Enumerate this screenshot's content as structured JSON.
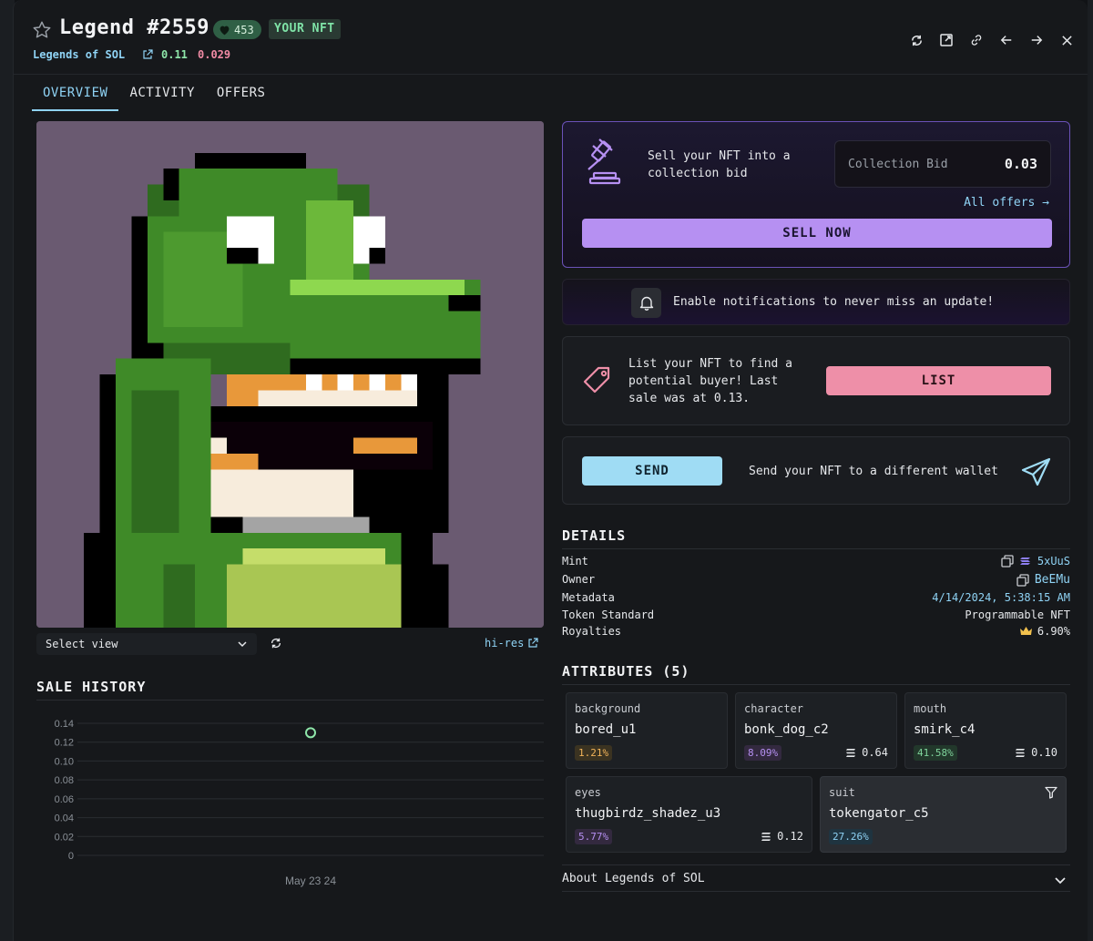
{
  "header": {
    "title": "Legend #2559",
    "likes": "453",
    "owner_badge": "YOUR NFT",
    "collection": "Legends of SOL",
    "floor_price": "0.11",
    "floor_change": "0.029",
    "actions": [
      "refresh-icon",
      "external-link-icon",
      "link-icon",
      "arrow-left-icon",
      "arrow-right-icon",
      "close-icon"
    ]
  },
  "tabs": [
    {
      "label": "OVERVIEW",
      "active": true
    },
    {
      "label": "ACTIVITY",
      "active": false
    },
    {
      "label": "OFFERS",
      "active": false
    }
  ],
  "image_controls": {
    "select_view": "Select view",
    "hires": "hi-res"
  },
  "sale_history": {
    "title": "SALE HISTORY"
  },
  "chart_data": {
    "type": "scatter",
    "title": "",
    "xlabel": "",
    "ylabel": "",
    "ylim": [
      0,
      0.14
    ],
    "yticks": [
      "0.14",
      "0.12",
      "0.10",
      "0.08",
      "0.06",
      "0.04",
      "0.02",
      "0"
    ],
    "xticks": [
      "May 23 24"
    ],
    "points": [
      {
        "x": "May 23 24",
        "y": 0.13
      }
    ],
    "grid": true,
    "point_color": "#8ee6a9"
  },
  "sell": {
    "text": "Sell your NFT into a collection bid",
    "bid_label": "Collection Bid",
    "bid_value": "0.03",
    "all_offers": "All offers →",
    "button": "SELL NOW"
  },
  "notify": {
    "text": "Enable notifications to never miss an update!"
  },
  "list": {
    "text": "List your NFT to find a potential buyer! Last sale was at 0.13.",
    "button": "LIST"
  },
  "send": {
    "button": "SEND",
    "text": "Send your NFT to a different wallet"
  },
  "details": {
    "title": "DETAILS",
    "rows": [
      {
        "key": "Mint",
        "value": "5xUuS"
      },
      {
        "key": "Owner",
        "value": "BeEMu"
      },
      {
        "key": "Metadata",
        "value": "4/14/2024, 5:38:15 AM"
      },
      {
        "key": "Token Standard",
        "value": "Programmable NFT"
      },
      {
        "key": "Royalties",
        "value": "6.90%"
      }
    ]
  },
  "attributes": {
    "title": "ATTRIBUTES (5)",
    "items": [
      {
        "trait": "background",
        "value": "bored_u1",
        "pct": "1.21%",
        "price": ""
      },
      {
        "trait": "character",
        "value": "bonk_dog_c2",
        "pct": "8.09%",
        "price": "0.64"
      },
      {
        "trait": "mouth",
        "value": "smirk_c4",
        "pct": "41.58%",
        "price": "0.10"
      },
      {
        "trait": "eyes",
        "value": "thugbirdz_shadez_u3",
        "pct": "5.77%",
        "price": "0.12"
      },
      {
        "trait": "suit",
        "value": "tokengator_c5",
        "pct": "27.26%",
        "price": ""
      }
    ]
  },
  "about": {
    "label": "About Legends of SOL"
  },
  "colors": {
    "accent_blue": "#8fd3f5",
    "sell_purple": "#b690f2",
    "list_pink": "#ee8fa8",
    "send_blue": "#9fdcf4",
    "art_background": "#6a5a71"
  }
}
